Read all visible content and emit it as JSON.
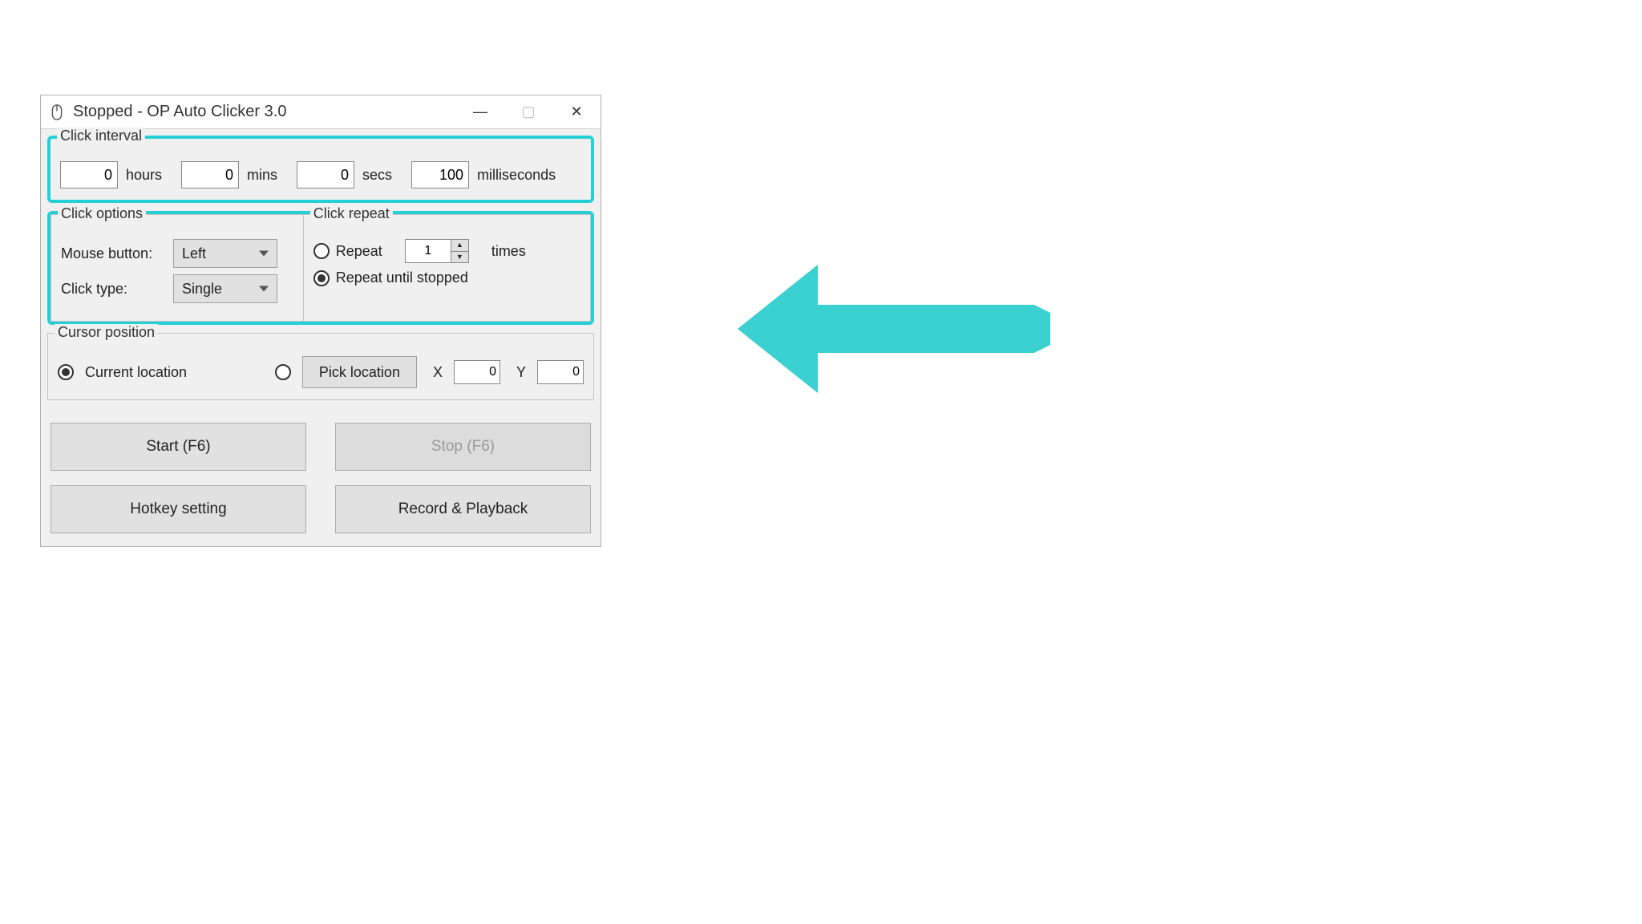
{
  "window": {
    "title": "Stopped - OP Auto Clicker 3.0",
    "minimize_glyph": "—",
    "maximize_glyph": "▢",
    "close_glyph": "✕"
  },
  "click_interval": {
    "legend": "Click interval",
    "hours": "0",
    "hours_unit": "hours",
    "mins": "0",
    "mins_unit": "mins",
    "secs": "0",
    "secs_unit": "secs",
    "ms": "100",
    "ms_unit": "milliseconds"
  },
  "click_options": {
    "legend": "Click options",
    "mouse_button_label": "Mouse button:",
    "mouse_button_value": "Left",
    "click_type_label": "Click type:",
    "click_type_value": "Single"
  },
  "click_repeat": {
    "legend": "Click repeat",
    "repeat_label": "Repeat",
    "repeat_count": "1",
    "times_label": "times",
    "until_stopped_label": "Repeat until stopped"
  },
  "cursor_position": {
    "legend": "Cursor position",
    "current_label": "Current location",
    "pick_button": "Pick location",
    "x_label": "X",
    "x_value": "0",
    "y_label": "Y",
    "y_value": "0"
  },
  "buttons": {
    "start": "Start (F6)",
    "stop": "Stop (F6)",
    "hotkey": "Hotkey setting",
    "record": "Record & Playback"
  },
  "annotation": {
    "arrow_color": "#3bd1d1"
  }
}
